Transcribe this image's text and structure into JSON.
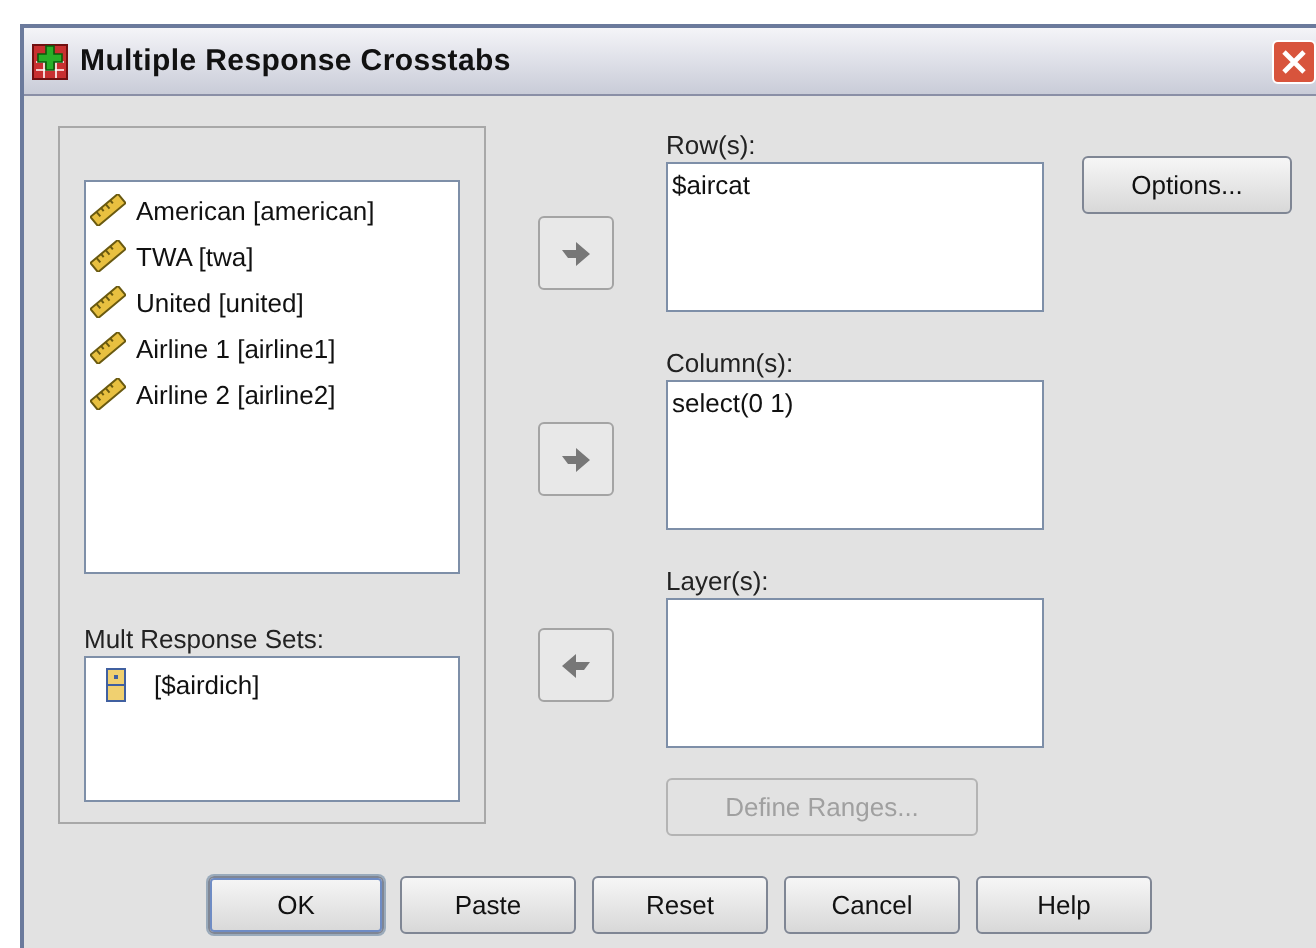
{
  "window": {
    "title": "Multiple Response Crosstabs"
  },
  "source_list": {
    "items": [
      {
        "label": "American [american]",
        "kind": "scale"
      },
      {
        "label": "TWA [twa]",
        "kind": "scale"
      },
      {
        "label": "United [united]",
        "kind": "scale"
      },
      {
        "label": "Airline 1 [airline1]",
        "kind": "scale"
      },
      {
        "label": "Airline 2 [airline2]",
        "kind": "scale"
      }
    ]
  },
  "mult_response_sets": {
    "label": "Mult Response Sets:",
    "items": [
      {
        "label": "[$airdich]",
        "kind": "set"
      }
    ]
  },
  "targets": [
    {
      "label": "Row(s):",
      "items": [
        "$aircat"
      ],
      "kind": "add"
    },
    {
      "label": "Column(s):",
      "items": [
        "select(0 1)"
      ],
      "kind": "add"
    },
    {
      "label": "Layer(s):",
      "kind": "remove"
    }
  ],
  "define_ranges": {
    "label": "Define Ranges...",
    "disabled": true
  },
  "options_button": {
    "label": "Options..."
  },
  "buttons": [
    {
      "label": "OK",
      "default": true
    },
    {
      "label": "Paste",
      "default": false
    },
    {
      "label": "Reset",
      "default": false
    },
    {
      "label": "Cancel",
      "default": false
    },
    {
      "label": "Help",
      "default": false
    }
  ]
}
